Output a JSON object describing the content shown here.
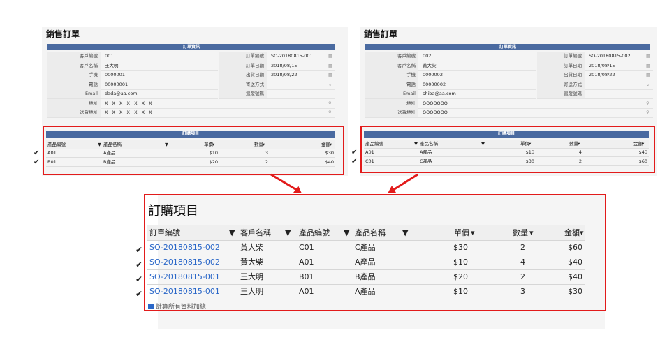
{
  "left": {
    "title": "銷售訂單",
    "section_title": "訂單資訊",
    "fields_left": [
      {
        "label": "客戶編號",
        "value": "001"
      },
      {
        "label": "客戶名稱",
        "value": "王大明"
      },
      {
        "label": "手機",
        "value": "0000001"
      },
      {
        "label": "電話",
        "value": "00000001"
      },
      {
        "label": "Email",
        "value": "dada@aa.com"
      },
      {
        "label": "地址",
        "value": "X X X X X X X"
      },
      {
        "label": "送貨地址",
        "value": "X X X X X X X"
      }
    ],
    "fields_right": [
      {
        "label": "訂單編號",
        "value": "SO-20180815-001"
      },
      {
        "label": "訂單日期",
        "value": "2018/08/15"
      },
      {
        "label": "出貨日期",
        "value": "2018/08/22"
      },
      {
        "label": "寄送方式",
        "value": ""
      },
      {
        "label": "追蹤號碼",
        "value": ""
      }
    ],
    "items_title": "訂購項目",
    "columns": [
      "產品編號",
      "產品名稱",
      "單價",
      "數量",
      "金額"
    ],
    "rows": [
      {
        "code": "A01",
        "name": "A產品",
        "price": "$10",
        "qty": "3",
        "amount": "$30"
      },
      {
        "code": "B01",
        "name": "B產品",
        "price": "$20",
        "qty": "2",
        "amount": "$40"
      }
    ]
  },
  "right": {
    "title": "銷售訂單",
    "section_title": "訂單資訊",
    "fields_left": [
      {
        "label": "客戶編號",
        "value": "002"
      },
      {
        "label": "客戶名稱",
        "value": "黃大柴"
      },
      {
        "label": "手機",
        "value": "0000002"
      },
      {
        "label": "電話",
        "value": "00000002"
      },
      {
        "label": "Email",
        "value": "shiba@aa.com"
      },
      {
        "label": "地址",
        "value": "OOOOOOO"
      },
      {
        "label": "送貨地址",
        "value": "OOOOOOO"
      }
    ],
    "fields_right": [
      {
        "label": "訂單編號",
        "value": "SO-20180815-002"
      },
      {
        "label": "訂單日期",
        "value": "2018/08/15"
      },
      {
        "label": "出貨日期",
        "value": "2018/08/22"
      },
      {
        "label": "寄送方式",
        "value": ""
      },
      {
        "label": "追蹤號碼",
        "value": ""
      }
    ],
    "items_title": "訂購項目",
    "columns": [
      "產品編號",
      "產品名稱",
      "單價",
      "數量",
      "金額"
    ],
    "rows": [
      {
        "code": "A01",
        "name": "A產品",
        "price": "$10",
        "qty": "4",
        "amount": "$40"
      },
      {
        "code": "C01",
        "name": "C產品",
        "price": "$30",
        "qty": "2",
        "amount": "$60"
      }
    ]
  },
  "bottom": {
    "title": "訂購項目",
    "columns": [
      "訂單編號",
      "客戶名稱",
      "產品編號",
      "產品名稱",
      "單價",
      "數量",
      "金額"
    ],
    "rows": [
      {
        "order": "SO-20180815-002",
        "customer": "黃大柴",
        "code": "C01",
        "name": "C產品",
        "price": "$30",
        "qty": "2",
        "amount": "$60"
      },
      {
        "order": "SO-20180815-002",
        "customer": "黃大柴",
        "code": "A01",
        "name": "A產品",
        "price": "$10",
        "qty": "4",
        "amount": "$40"
      },
      {
        "order": "SO-20180815-001",
        "customer": "王大明",
        "code": "B01",
        "name": "B產品",
        "price": "$20",
        "qty": "2",
        "amount": "$40"
      },
      {
        "order": "SO-20180815-001",
        "customer": "王大明",
        "code": "A01",
        "name": "A產品",
        "price": "$10",
        "qty": "3",
        "amount": "$30"
      }
    ],
    "sum_label": "計算所有資料加總"
  },
  "colors": {
    "accent": "#4a6aa0",
    "highlight": "#e21b1b",
    "link": "#2a67c8"
  },
  "icons": [
    "calendar-icon",
    "dropdown-caret-icon",
    "map-pin-icon",
    "sort-caret-icon",
    "checkmark-icon",
    "calculator-icon",
    "arrow-icon"
  ]
}
